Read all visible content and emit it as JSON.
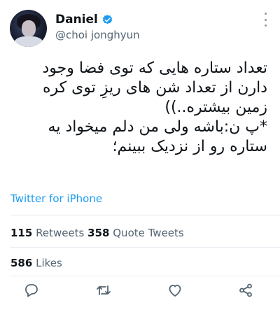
{
  "author": {
    "name": "Daniel",
    "handle": "@choi jonghyun",
    "verified_color": "#1d9bf0"
  },
  "tweet": {
    "text": "تعداد ستاره هایی که توی فضا وجود\nدارن از تعداد شن های ریزِ توی کره\nزمین بیشتره..))\n*پ ن:باشه ولی من دلم میخواد یه\nستاره رو از نزدیک ببینم؛",
    "source": "Twitter for iPhone"
  },
  "stats": {
    "retweets_count": "115",
    "retweets_label": "Retweets",
    "quotes_count": "358",
    "quotes_label": "Quote Tweets",
    "likes_count": "586",
    "likes_label": "Likes"
  },
  "actions": [
    "reply-icon",
    "retweet-icon",
    "like-icon",
    "share-icon"
  ],
  "colors": {
    "accent": "#1d9bf0",
    "muted": "#536471",
    "icon": "#536471"
  }
}
